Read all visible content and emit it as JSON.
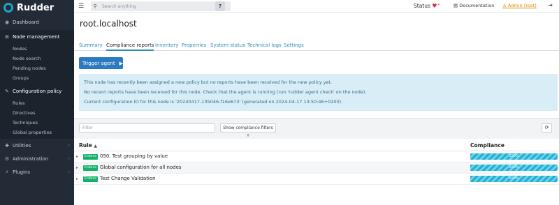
{
  "brand": {
    "name": "Rudder"
  },
  "sidebar": {
    "items": [
      {
        "label": "Dashboard",
        "icon": "dashboard-icon"
      },
      {
        "label": "Node management",
        "icon": "sitemap-icon",
        "children": [
          "Nodes",
          "Node search",
          "Pending nodes",
          "Groups"
        ]
      },
      {
        "label": "Configuration policy",
        "icon": "pencil-icon",
        "children": [
          "Rules",
          "Directives",
          "Techniques",
          "Global properties"
        ]
      },
      {
        "label": "Utilities",
        "icon": "wrench-icon"
      },
      {
        "label": "Administration",
        "icon": "gear-icon"
      },
      {
        "label": "Plugins",
        "icon": "plug-icon"
      }
    ]
  },
  "topbar": {
    "search_placeholder": "Search anything",
    "help": "?",
    "status": "Status",
    "documentation": "Documentation",
    "user": "Admin (root)"
  },
  "page": {
    "title": "root.localhost",
    "tabs": [
      "Summary",
      "Compliance reports",
      "Inventory",
      "Properties",
      "System status",
      "Technical logs",
      "Settings"
    ],
    "active_tab": "Compliance reports",
    "trigger_label": "Trigger agent",
    "alerts": [
      "This node has recently been assigned a new policy but no reports have been received for the new policy yet.",
      "No recent reports have been received for this node. Check that the agent is running (run 'rudder agent check' on the node).",
      "Current configuration ID for this node is '20240417-135046-f16e673' (generated on 2024-04-17 13:50:46+0200)."
    ],
    "filter_placeholder": "Filter",
    "filters_button": "Show compliance filters +",
    "table": {
      "headers": {
        "rule": "Rule",
        "compliance": "Compliance"
      },
      "rows": [
        {
          "badge": "Enforce",
          "name": "050. Test grouping by value",
          "compliance": "100%"
        },
        {
          "badge": "Enforce",
          "name": "Global configuration for all nodes",
          "compliance": "100%"
        },
        {
          "badge": "Enforce",
          "name": "Test Change Validation",
          "compliance": "100%"
        }
      ]
    }
  },
  "colors": {
    "sidebar_bg": "#222b36",
    "accent": "#2a7bbf",
    "enforce": "#13b16a",
    "compliance": "#1fb0d3",
    "alert_bg": "#d9edf7"
  }
}
